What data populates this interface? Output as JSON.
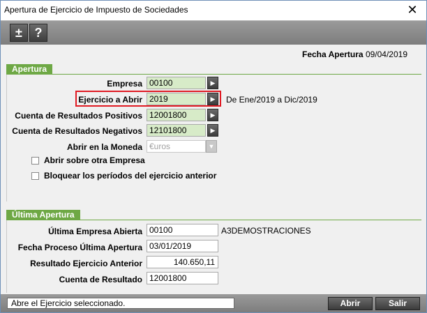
{
  "window": {
    "title": "Apertura de Ejercicio de Impuesto de Sociedades",
    "close_glyph": "✕"
  },
  "toolbar": {
    "plusminus_glyph": "±",
    "help_glyph": "?"
  },
  "header": {
    "fecha_label": "Fecha Apertura",
    "fecha_value": "09/04/2019"
  },
  "apertura": {
    "section_label": "Apertura",
    "empresa_label": "Empresa",
    "empresa_value": "00100",
    "ejercicio_label": "Ejercicio a Abrir",
    "ejercicio_value": "2019",
    "ejercicio_range": "De Ene/2019 a Dic/2019",
    "cta_pos_label": "Cuenta de Resultados Positivos",
    "cta_pos_value": "12001800",
    "cta_neg_label": "Cuenta de Resultados Negativos",
    "cta_neg_value": "12101800",
    "moneda_label": "Abrir en la Moneda",
    "moneda_value": "€uros",
    "chk_otra_empresa": "Abrir sobre otra Empresa",
    "chk_bloquear": "Bloquear los períodos del ejercicio anterior",
    "highlight_color": "#e01922"
  },
  "ultima": {
    "section_label": "Última Apertura",
    "empresa_label": "Última Empresa Abierta",
    "empresa_value": "00100",
    "empresa_name": "A3DEMOSTRACIONES",
    "fecha_label": "Fecha Proceso Última Apertura",
    "fecha_value": "03/01/2019",
    "resultado_label": "Resultado Ejercicio Anterior",
    "resultado_value": "140.650,11",
    "cuenta_label": "Cuenta de Resultado",
    "cuenta_value": "12001800"
  },
  "status": {
    "message": "Abre el Ejercicio seleccionado.",
    "abrir_label": "Abrir",
    "salir_label": "Salir"
  },
  "colors": {
    "section_green": "#6ea845",
    "field_green": "#d7ebc8"
  },
  "icons": {
    "arrow": "▶",
    "dropdown": "▼"
  }
}
